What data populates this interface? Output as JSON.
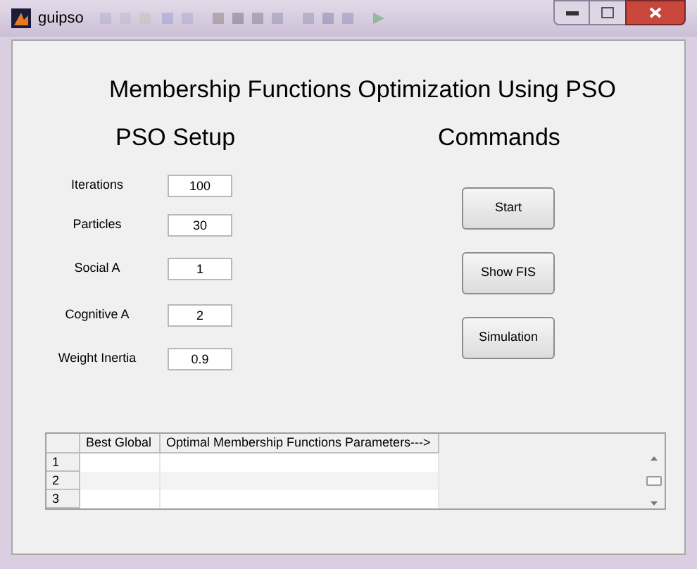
{
  "window": {
    "title": "guipso"
  },
  "heading": "Membership Functions Optimization Using PSO",
  "setup": {
    "title": "PSO Setup",
    "fields": [
      {
        "label": "Iterations",
        "value": "100"
      },
      {
        "label": "Particles",
        "value": "30"
      },
      {
        "label": "Social A",
        "value": "1"
      },
      {
        "label": "Cognitive A",
        "value": "2"
      },
      {
        "label": "Weight Inertia",
        "value": "0.9"
      }
    ]
  },
  "commands": {
    "title": "Commands",
    "buttons": [
      "Start",
      "Show FIS",
      "Simulation"
    ]
  },
  "table": {
    "columns": [
      "Best Global",
      "Optimal Membership Functions Parameters--->"
    ],
    "rows": [
      "1",
      "2",
      "3"
    ]
  }
}
